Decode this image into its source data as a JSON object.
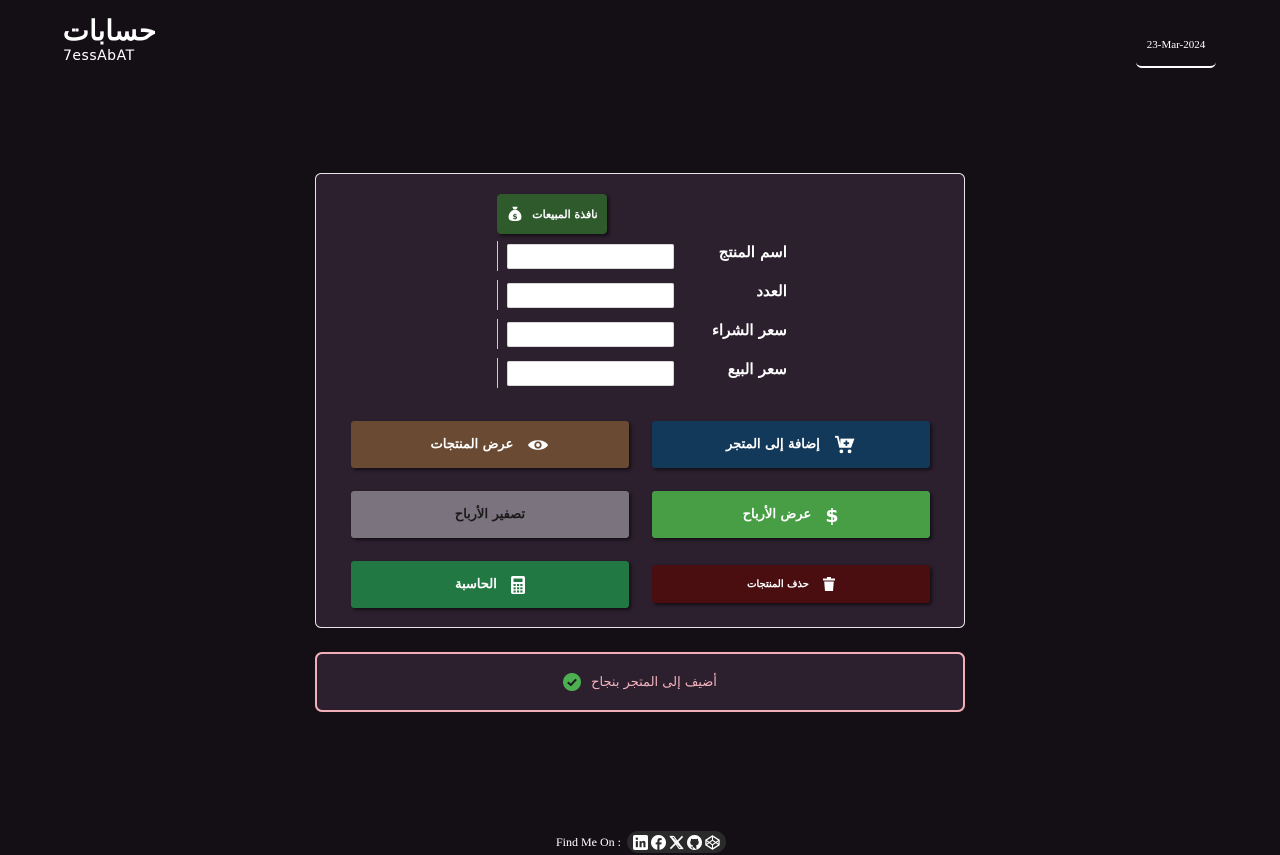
{
  "header": {
    "brand_ar": "حسابات",
    "brand_en": "7essAbAT",
    "date": "23-Mar-2024"
  },
  "card": {
    "sales_window_label": "نافذة المبيعات",
    "fields": [
      {
        "label": "اسم المنتج",
        "value": "",
        "placeholder": ""
      },
      {
        "label": "العدد",
        "value": "",
        "placeholder": ""
      },
      {
        "label": "سعر الشراء",
        "value": "",
        "placeholder": ""
      },
      {
        "label": "سعر البيع",
        "value": "",
        "placeholder": ""
      }
    ],
    "buttons": {
      "add_to_store": "إضافة إلى المتجر",
      "view_products": "عرض المنتجات",
      "view_profits": "عرض الأرباح",
      "reset_profits": "تصفير الأرباح",
      "delete_products": "حذف المنتجات",
      "calculator": "الحاسبة"
    }
  },
  "alert": {
    "message": "أضيف إلى المتجر بنجاح",
    "color": "#f3b3bd"
  },
  "footer": {
    "label": "Find Me On :",
    "icons": [
      "linkedin-icon",
      "facebook-icon",
      "x-icon",
      "github-icon",
      "codepen-icon"
    ]
  },
  "colors": {
    "background": "#130f14",
    "card": "#2c1f2e",
    "add_button": "#13395a",
    "view_button": "#6a4a32",
    "profits_button": "#479e45",
    "reset_button": "#7b737d",
    "delete_button": "#4a0d10",
    "calculator_button": "#217842",
    "sales_button": "#2e5a2c"
  }
}
